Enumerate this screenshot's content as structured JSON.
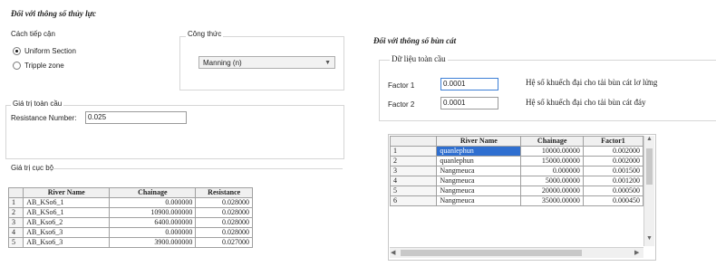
{
  "left": {
    "title": "Đối với thông số thủy lực",
    "calc_label": "Cách tiếp cận",
    "radio_uniform": "Uniform Section",
    "radio_triple": "Tripple zone",
    "formula_label": "Công thức",
    "formula_value": "Manning (n)",
    "global_label": "Giá trị toàn cầu",
    "resistance_label": "Resistance Number:",
    "resistance_value": "0.025",
    "local_label": "Giá trị cục bộ",
    "table": {
      "headers": [
        "River Name",
        "Chainage",
        "Resistance"
      ],
      "rows": [
        [
          "1",
          "AB_KSo6_1",
          "0.000000",
          "0.028000"
        ],
        [
          "2",
          "AB_KSo6_1",
          "10900.000000",
          "0.028000"
        ],
        [
          "3",
          "AB_Kso6_2",
          "6400.000000",
          "0.028000"
        ],
        [
          "4",
          "AB_Kso6_3",
          "0.000000",
          "0.028000"
        ],
        [
          "5",
          "AB_Kso6_3",
          "3900.000000",
          "0.027000"
        ]
      ]
    }
  },
  "right": {
    "title": "Đối với thông số bùn cát",
    "global_label": "Dữ liệu toàn cầu",
    "factor1_label": "Factor 1",
    "factor1_value": "0.0001",
    "factor1_desc": "Hệ số khuếch đại cho tải bùn cát lơ lửng",
    "factor2_label": "Factor 2",
    "factor2_value": "0.0001",
    "factor2_desc": "Hệ số khuếch đại cho tải bùn cát đáy",
    "table": {
      "headers": [
        "River Name",
        "Chainage",
        "Factor1"
      ],
      "rows": [
        [
          "1",
          "quanlephun",
          "10000.00000",
          "0.002000"
        ],
        [
          "2",
          "quanlephun",
          "15000.00000",
          "0.002000"
        ],
        [
          "3",
          "Nangmeuca",
          "0.000000",
          "0.001500"
        ],
        [
          "4",
          "Nangmeuca",
          "5000.00000",
          "0.001200"
        ],
        [
          "5",
          "Nangmeuca",
          "20000.00000",
          "0.000500"
        ],
        [
          "6",
          "Nangmeuca",
          "35000.00000",
          "0.000450"
        ]
      ]
    }
  }
}
